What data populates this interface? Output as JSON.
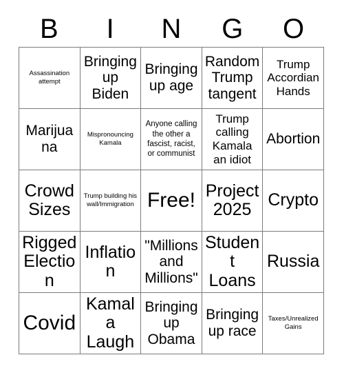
{
  "card": {
    "title": "BINGO Card",
    "header_letters": [
      "B",
      "I",
      "N",
      "G",
      "O"
    ],
    "colors": {
      "background": "#ffffff",
      "text": "#000000",
      "grid_line": "#7a7a7a"
    },
    "grid": {
      "columns": 5,
      "rows": 5,
      "free_space_index": 12,
      "cells": [
        {
          "text": "Assassination attempt",
          "size": "xs"
        },
        {
          "text": "Bringing up Biden",
          "size": "lg"
        },
        {
          "text": "Bringing up age",
          "size": "lg"
        },
        {
          "text": "Random Trump tangent",
          "size": "lg"
        },
        {
          "text": "Trump Accordian Hands",
          "size": "md"
        },
        {
          "text": "Marijuana",
          "size": "lg"
        },
        {
          "text": "Mispronouncing Kamala",
          "size": "xs"
        },
        {
          "text": "Anyone calling the other a fascist, racist, or communist",
          "size": "sm"
        },
        {
          "text": "Trump calling Kamala an idiot",
          "size": "md"
        },
        {
          "text": "Abortion",
          "size": "lg"
        },
        {
          "text": "Crowd Sizes",
          "size": "xl"
        },
        {
          "text": "Trump building his wall/Immigration",
          "size": "xs"
        },
        {
          "text": "Free!",
          "size": "xxl"
        },
        {
          "text": "Project 2025",
          "size": "xl"
        },
        {
          "text": "Crypto",
          "size": "xl"
        },
        {
          "text": "Rigged Election",
          "size": "xl"
        },
        {
          "text": "Inflation",
          "size": "xl"
        },
        {
          "text": "\"Millions and Millions\"",
          "size": "lg"
        },
        {
          "text": "Student Loans",
          "size": "xl"
        },
        {
          "text": "Russia",
          "size": "xl"
        },
        {
          "text": "Covid",
          "size": "xxl"
        },
        {
          "text": "Kamala Laugh",
          "size": "xl"
        },
        {
          "text": "Bringing up Obama",
          "size": "lg"
        },
        {
          "text": "Bringing up race",
          "size": "lg"
        },
        {
          "text": "Taxes/Unrealized Gains",
          "size": "xs"
        }
      ]
    }
  }
}
